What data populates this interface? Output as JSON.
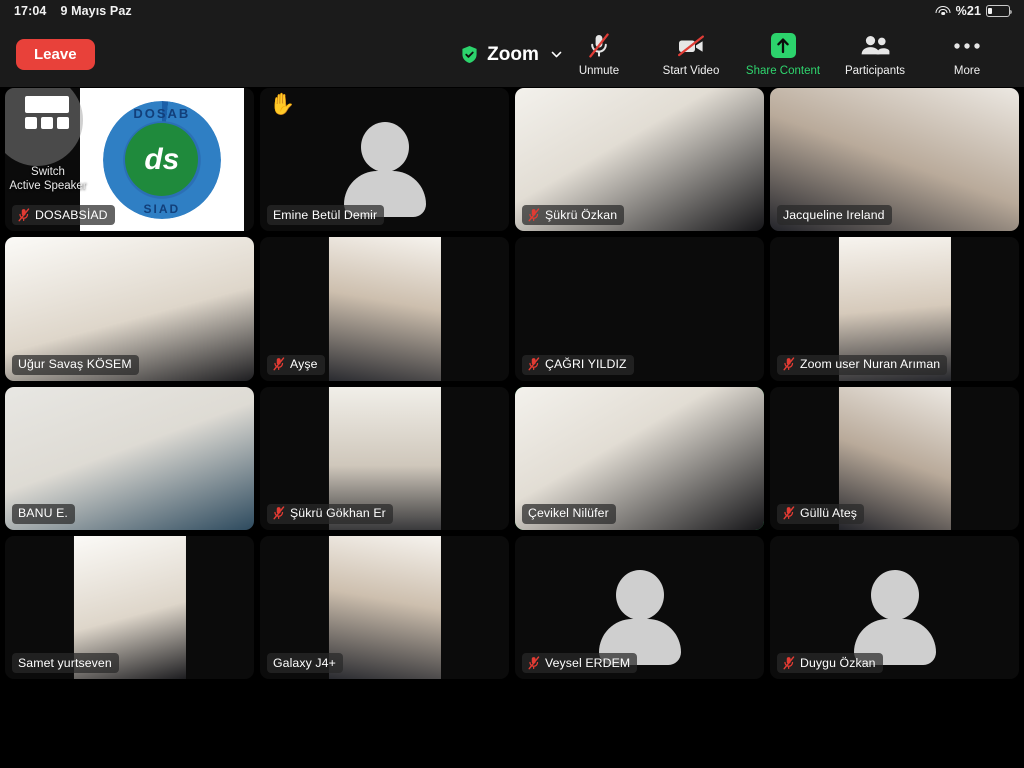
{
  "status_bar": {
    "time": "17:04",
    "date": "9 Mayıs Paz",
    "battery_text": "%21",
    "battery_level": 21,
    "wifi_icon": "wifi-icon",
    "battery_icon": "battery-icon"
  },
  "toolbar": {
    "leave_label": "Leave",
    "meeting_title": "Zoom",
    "encryption_icon": "shield-check-icon",
    "title_chevron_icon": "chevron-down-icon",
    "buttons": [
      {
        "label": "Unmute",
        "icon": "mic-muted-icon",
        "active": false
      },
      {
        "label": "Start Video",
        "icon": "camera-off-icon",
        "active": false
      },
      {
        "label": "Share Content",
        "icon": "share-screen-icon",
        "active": true
      },
      {
        "label": "Participants",
        "icon": "participants-icon",
        "active": false
      },
      {
        "label": "More",
        "icon": "ellipsis-icon",
        "active": false
      }
    ],
    "accent_green": "#2cd36c",
    "leave_red": "#e8413a"
  },
  "overlay": {
    "switch_label_line1": "Switch",
    "switch_label_line2": "Active Speaker",
    "switch_icon": "gallery-view-icon"
  },
  "gallery": {
    "active_speaker_border": "#2fe06a",
    "columns": 4,
    "rows": 4,
    "participants": [
      {
        "name": "DOSABSİAD",
        "muted": true,
        "video": "logo",
        "hand_raised": false,
        "active": false,
        "switch_overlay": true
      },
      {
        "name": "Emine Betül Demir",
        "muted": false,
        "video": "avatar",
        "hand_raised": true,
        "active": false,
        "switch_overlay": false
      },
      {
        "name": "Şükrü Özkan",
        "muted": true,
        "video": "full",
        "hand_raised": false,
        "active": false,
        "switch_overlay": false
      },
      {
        "name": "Jacqueline Ireland",
        "muted": false,
        "video": "full",
        "hand_raised": false,
        "active": false,
        "switch_overlay": false
      },
      {
        "name": "Uğur Savaş KÖSEM",
        "muted": false,
        "video": "full",
        "hand_raised": false,
        "active": false,
        "switch_overlay": false
      },
      {
        "name": "Ayşe",
        "muted": true,
        "video": "portrait",
        "hand_raised": false,
        "active": false,
        "switch_overlay": false
      },
      {
        "name": "ÇAĞRI YILDIZ",
        "muted": true,
        "video": "off",
        "hand_raised": false,
        "active": false,
        "switch_overlay": false
      },
      {
        "name": "Zoom user Nuran Arıman",
        "muted": true,
        "video": "portrait",
        "hand_raised": false,
        "active": false,
        "switch_overlay": false
      },
      {
        "name": "BANU E.",
        "muted": false,
        "video": "full",
        "hand_raised": false,
        "active": false,
        "switch_overlay": false
      },
      {
        "name": "Şükrü Gökhan  Er",
        "muted": true,
        "video": "portrait",
        "hand_raised": false,
        "active": false,
        "switch_overlay": false
      },
      {
        "name": "Çevikel Nilüfer",
        "muted": false,
        "video": "full",
        "hand_raised": false,
        "active": true,
        "switch_overlay": false
      },
      {
        "name": "Güllü Ateş",
        "muted": true,
        "video": "portrait",
        "hand_raised": false,
        "active": false,
        "switch_overlay": false
      },
      {
        "name": "Samet yurtseven",
        "muted": false,
        "video": "portrait",
        "hand_raised": false,
        "active": false,
        "switch_overlay": false
      },
      {
        "name": "Galaxy J4+",
        "muted": false,
        "video": "portrait",
        "hand_raised": false,
        "active": false,
        "switch_overlay": false
      },
      {
        "name": "Veysel ERDEM",
        "muted": true,
        "video": "avatar",
        "hand_raised": false,
        "active": false,
        "switch_overlay": false
      },
      {
        "name": "Duygu Özkan",
        "muted": true,
        "video": "avatar",
        "hand_raised": false,
        "active": false,
        "switch_overlay": false
      }
    ]
  },
  "logo_tile": {
    "top_text": "DOSAB",
    "bottom_text": "SIAD",
    "center_text": "ds"
  }
}
